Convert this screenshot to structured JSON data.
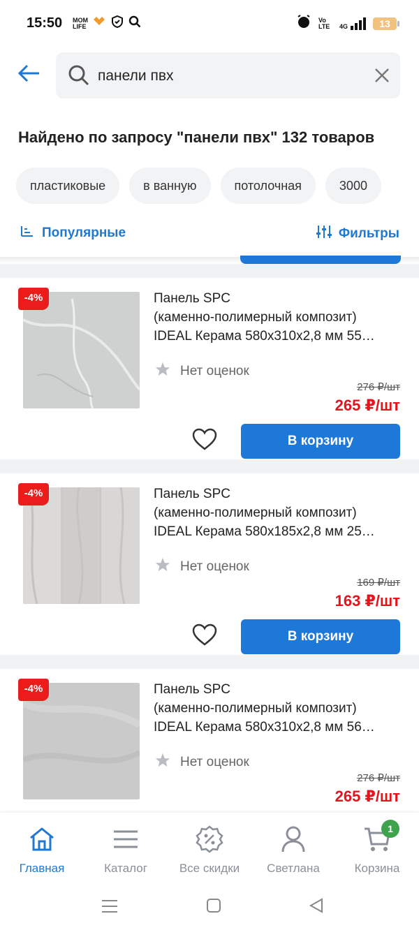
{
  "status_bar": {
    "time": "15:50",
    "battery": "13",
    "network": "4G",
    "volte": "Vo LTE",
    "mom_life": "MOM LIFE"
  },
  "search": {
    "query": "панели пвх"
  },
  "results_title": "Найдено по запросу \"панели пвх\" 132 товаров",
  "chips": [
    "пластиковые",
    "в ванную",
    "потолочная",
    "3000"
  ],
  "sort_label": "Популярные",
  "filters_label": "Фильтры",
  "products": [
    {
      "discount": "-4%",
      "title_line1": "Панель SPC",
      "title_line2": "(каменно-полимерный композит)",
      "title_line3": "IDEAL Керама 580х310х2,8 мм 55…",
      "rating": "Нет оценок",
      "old_price": "276 ₽/шт",
      "price": "265 ₽/шт",
      "cart_label": "В корзину"
    },
    {
      "discount": "-4%",
      "title_line1": "Панель SPC",
      "title_line2": "(каменно-полимерный композит)",
      "title_line3": "IDEAL Керама 580х185х2,8 мм 25…",
      "rating": "Нет оценок",
      "old_price": "169 ₽/шт",
      "price": "163 ₽/шт",
      "cart_label": "В корзину"
    },
    {
      "discount": "-4%",
      "title_line1": "Панель SPC",
      "title_line2": "(каменно-полимерный композит)",
      "title_line3": "IDEAL Керама 580х310х2,8 мм 56…",
      "rating": "Нет оценок",
      "old_price": "276 ₽/шт",
      "price": "265 ₽/шт"
    }
  ],
  "nav": {
    "home": "Главная",
    "catalog": "Каталог",
    "discounts": "Все скидки",
    "profile": "Светлана",
    "cart": "Корзина",
    "cart_count": "1"
  },
  "colors": {
    "accent": "#1e78d7",
    "price": "#e3141c",
    "discount_bg": "#ea1c1c",
    "badge": "#3fa34d"
  }
}
